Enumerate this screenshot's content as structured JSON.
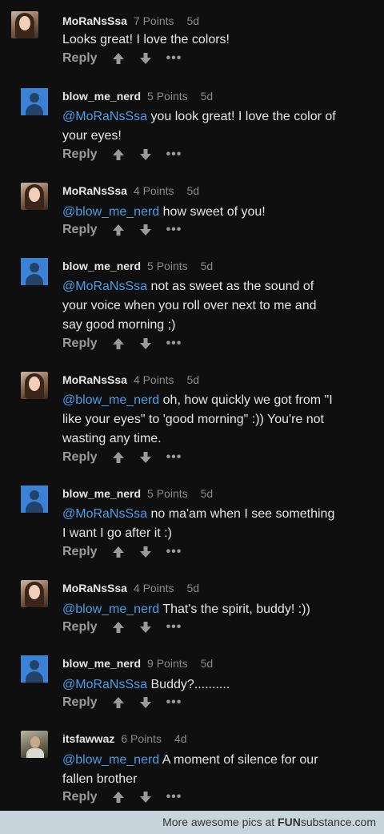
{
  "comments": [
    {
      "user": "MoRaNsSsa",
      "points": "7 Points",
      "time": "5d",
      "mention": "",
      "text": "Looks great! I love the colors!",
      "reply": "Reply",
      "more": "•••"
    },
    {
      "user": "blow_me_nerd",
      "points": "5 Points",
      "time": "5d",
      "mention": "@MoRaNsSsa",
      "text": " you look great! I love the color of your eyes!",
      "reply": "Reply",
      "more": "•••"
    },
    {
      "user": "MoRaNsSsa",
      "points": "4 Points",
      "time": "5d",
      "mention": "@blow_me_nerd",
      "text": " how sweet of you!",
      "reply": "Reply",
      "more": "•••"
    },
    {
      "user": "blow_me_nerd",
      "points": "5 Points",
      "time": "5d",
      "mention": "@MoRaNsSsa",
      "text": " not as sweet as the sound of your voice when you roll over next to me and say good morning ;)",
      "reply": "Reply",
      "more": "•••"
    },
    {
      "user": "MoRaNsSsa",
      "points": "4 Points",
      "time": "5d",
      "mention": "@blow_me_nerd",
      "text": " oh, how quickly we got from \"I like your eyes\" to 'good morning\" :)) You're not wasting any time.",
      "reply": "Reply",
      "more": "•••"
    },
    {
      "user": "blow_me_nerd",
      "points": "5 Points",
      "time": "5d",
      "mention": "@MoRaNsSsa",
      "text": " no ma'am when I see something I want I go after it :)",
      "reply": "Reply",
      "more": "•••"
    },
    {
      "user": "MoRaNsSsa",
      "points": "4 Points",
      "time": "5d",
      "mention": "@blow_me_nerd",
      "text": " That's the spirit, buddy! :))",
      "reply": "Reply",
      "more": "•••"
    },
    {
      "user": "blow_me_nerd",
      "points": "9 Points",
      "time": "5d",
      "mention": "@MoRaNsSsa",
      "text": " Buddy?..........",
      "reply": "Reply",
      "more": "•••"
    },
    {
      "user": "itsfawwaz",
      "points": "6 Points",
      "time": "4d",
      "mention": "@blow_me_nerd",
      "text": " A moment of silence for our fallen brother",
      "reply": "Reply",
      "more": "•••"
    }
  ],
  "footer": {
    "text": "More awesome pics at ",
    "brand_bold": "FUN",
    "brand_rest": "substance",
    "brand_suffix": ".com"
  },
  "colors": {
    "mention": "#4a9ee8",
    "default_avatar": "#3b82d4",
    "background": "#0f0f0f"
  }
}
